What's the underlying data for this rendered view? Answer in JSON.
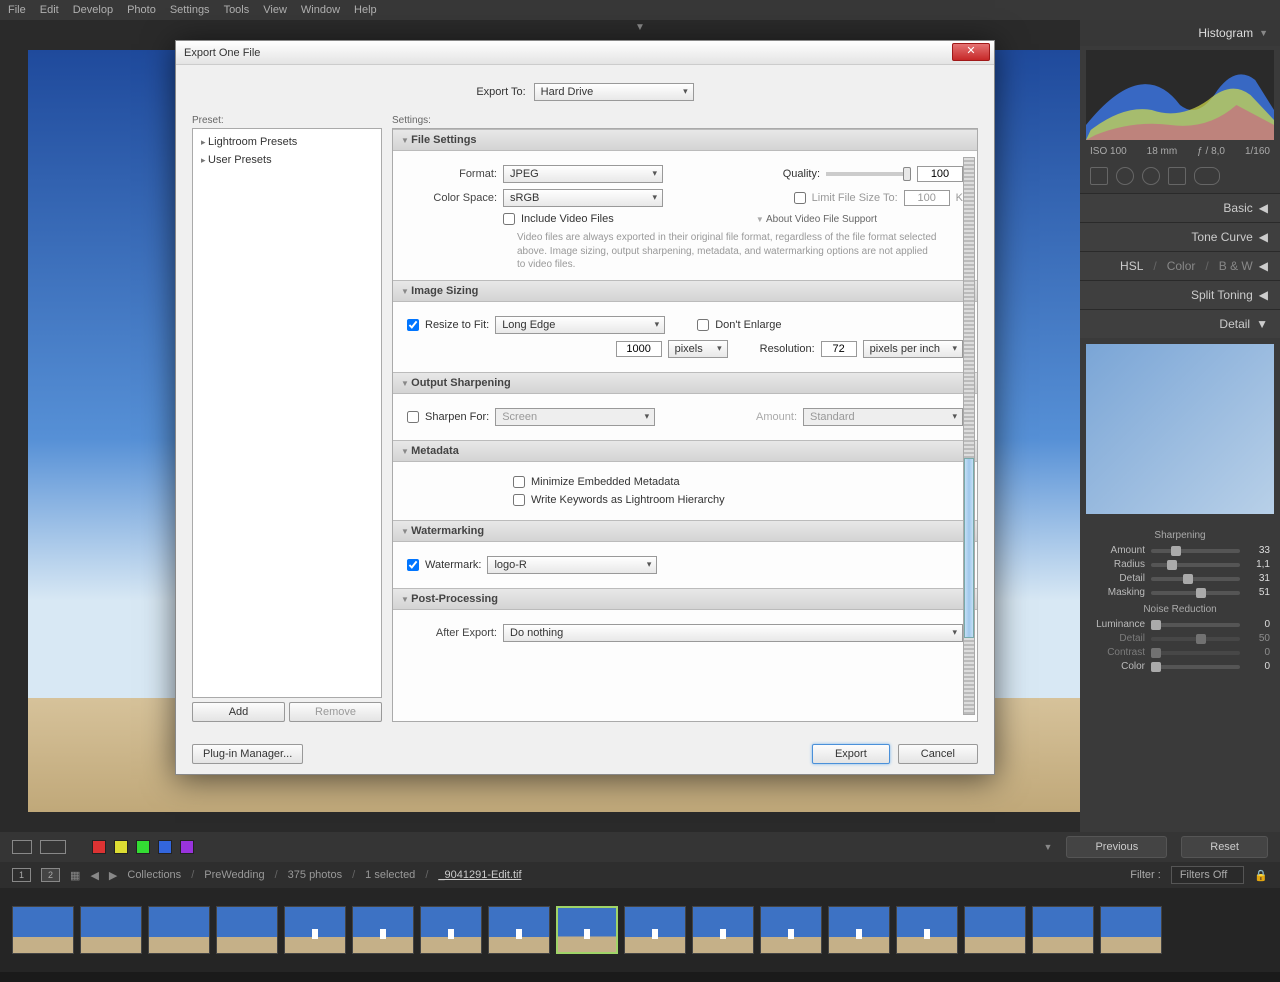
{
  "menu": [
    "File",
    "Edit",
    "Develop",
    "Photo",
    "Settings",
    "Tools",
    "View",
    "Window",
    "Help"
  ],
  "right": {
    "histogram_title": "Histogram",
    "meta": {
      "iso": "ISO 100",
      "focal": "18 mm",
      "aperture": "ƒ / 8,0",
      "shutter": "1/160"
    },
    "panels": [
      "Basic",
      "Tone Curve"
    ],
    "hsl": {
      "a": "HSL",
      "b": "Color",
      "c": "B & W"
    },
    "split": "Split Toning",
    "detail": "Detail",
    "sharpening_title": "Sharpening",
    "sh": [
      {
        "l": "Amount",
        "v": "33",
        "p": 22
      },
      {
        "l": "Radius",
        "v": "1,1",
        "p": 18
      },
      {
        "l": "Detail",
        "v": "31",
        "p": 36
      },
      {
        "l": "Masking",
        "v": "51",
        "p": 50
      }
    ],
    "noise_title": "Noise Reduction",
    "nr": [
      {
        "l": "Luminance",
        "v": "0",
        "p": 0,
        "dim": false
      },
      {
        "l": "Detail",
        "v": "50",
        "p": 50,
        "dim": true
      },
      {
        "l": "Contrast",
        "v": "0",
        "p": 0,
        "dim": true
      },
      {
        "l": "Color",
        "v": "0",
        "p": 0,
        "dim": false
      }
    ]
  },
  "bottom": {
    "previous": "Previous",
    "reset": "Reset"
  },
  "filmstrip": {
    "crumbs": [
      "Collections",
      "PreWedding",
      "375 photos",
      "1 selected"
    ],
    "file": "_9041291-Edit.tif",
    "filter_lbl": "Filter :",
    "filter_val": "Filters Off"
  },
  "dialog": {
    "title": "Export One File",
    "export_to_lbl": "Export To:",
    "export_to_val": "Hard Drive",
    "preset_lbl": "Preset:",
    "settings_lbl": "Settings:",
    "presets": [
      "Lightroom Presets",
      "User Presets"
    ],
    "add": "Add",
    "remove": "Remove",
    "plugin": "Plug-in Manager...",
    "export": "Export",
    "cancel": "Cancel",
    "fs": {
      "title": "File Settings",
      "format_lbl": "Format:",
      "format_val": "JPEG",
      "quality_lbl": "Quality:",
      "quality_val": "100",
      "cs_lbl": "Color Space:",
      "cs_val": "sRGB",
      "limit_lbl": "Limit File Size To:",
      "limit_val": "100",
      "limit_unit": "K",
      "video_chk": "Include Video Files",
      "video_hdr": "About Video File Support",
      "video_note": "Video files are always exported in their original file format, regardless of the file format selected above. Image sizing, output sharpening, metadata, and watermarking options are not applied to video files."
    },
    "sz": {
      "title": "Image Sizing",
      "resize_lbl": "Resize to Fit:",
      "resize_val": "Long Edge",
      "dont": "Don't Enlarge",
      "dim_val": "1000",
      "dim_unit": "pixels",
      "res_lbl": "Resolution:",
      "res_val": "72",
      "res_unit": "pixels per inch"
    },
    "os": {
      "title": "Output Sharpening",
      "sharp_lbl": "Sharpen For:",
      "sharp_val": "Screen",
      "amt_lbl": "Amount:",
      "amt_val": "Standard"
    },
    "md": {
      "title": "Metadata",
      "min": "Minimize Embedded Metadata",
      "kw": "Write Keywords as Lightroom Hierarchy"
    },
    "wm": {
      "title": "Watermarking",
      "lbl": "Watermark:",
      "val": "logo-R"
    },
    "pp": {
      "title": "Post-Processing",
      "lbl": "After Export:",
      "val": "Do nothing"
    }
  }
}
